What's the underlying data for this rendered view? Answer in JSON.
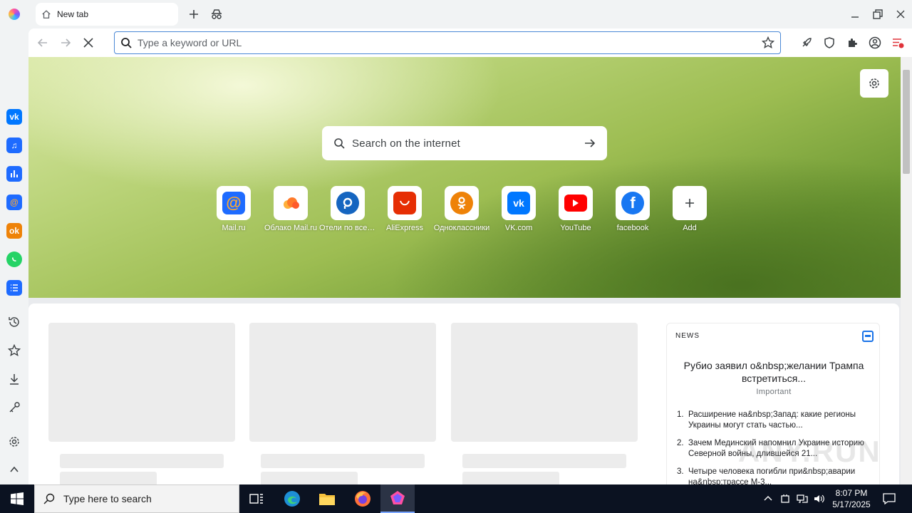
{
  "browser": {
    "tab_title": "New tab",
    "omnibox_placeholder": "Type a keyword or URL"
  },
  "sidebar": {
    "apps": [
      "vk",
      "music",
      "stats",
      "mail",
      "odnoklassniki",
      "whatsapp",
      "tasks"
    ],
    "tools": [
      "history",
      "bookmarks",
      "downloads",
      "passwords",
      "settings",
      "collapse"
    ]
  },
  "newtab": {
    "search_placeholder": "Search on the internet",
    "tiles": [
      {
        "label": "Mail.ru"
      },
      {
        "label": "Облако Mail.ru"
      },
      {
        "label": "Отели по всему миру"
      },
      {
        "label": "AliExpress"
      },
      {
        "label": "Одноклассники"
      },
      {
        "label": "VK.com"
      },
      {
        "label": "YouTube"
      },
      {
        "label": "facebook"
      },
      {
        "label": "Add"
      }
    ]
  },
  "news": {
    "title": "NEWS",
    "headline": "Рубио заявил o&nbsp;желании Трампа встретиться...",
    "tag": "Important",
    "items": [
      {
        "num": "1.",
        "text": "Расширение на&nbsp;Запад: какие регионы Украины могут стать частью..."
      },
      {
        "num": "2.",
        "text": "Зачем Мединский напомнил Украине историю Северной войны, длившейся 21..."
      },
      {
        "num": "3.",
        "text": "Четыре человека погибли при&nbsp;аварии на&nbsp;трассе М-3..."
      }
    ]
  },
  "watermark": "ANY.RUN",
  "taskbar": {
    "search_placeholder": "Type here to search",
    "time": "8:07 PM",
    "date": "5/17/2025"
  }
}
